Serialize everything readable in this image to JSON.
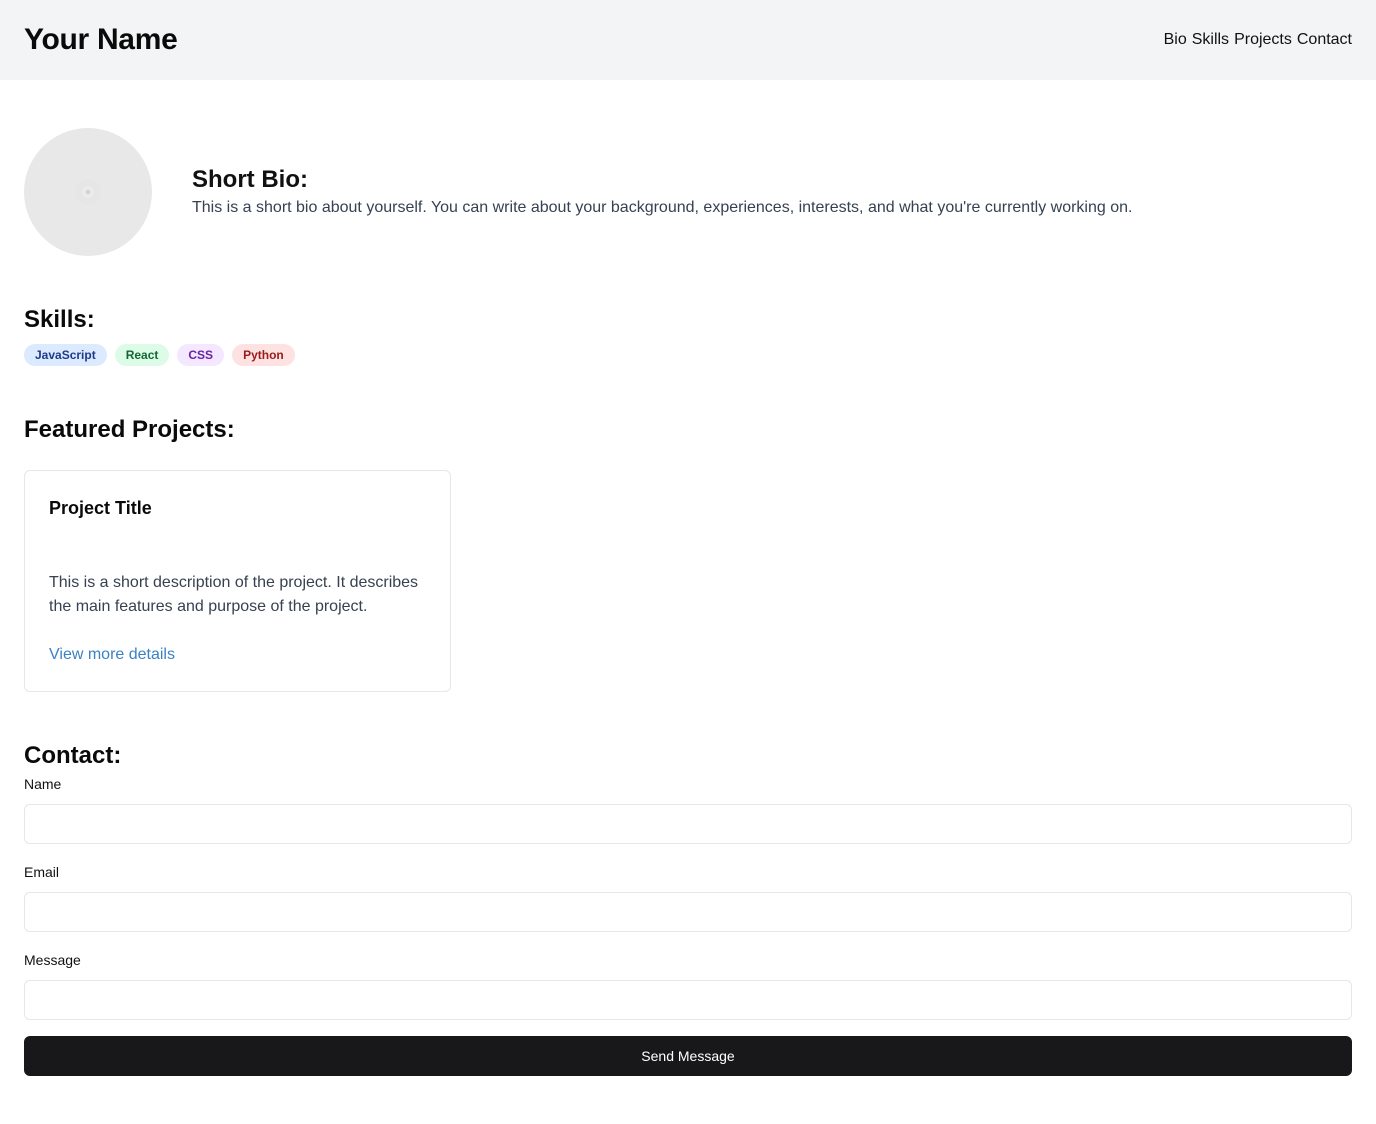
{
  "header": {
    "title": "Your Name",
    "nav": [
      {
        "label": "Bio"
      },
      {
        "label": "Skills"
      },
      {
        "label": "Projects"
      },
      {
        "label": "Contact"
      }
    ]
  },
  "bio": {
    "heading": "Short Bio:",
    "text": "This is a short bio about yourself. You can write about your background, experiences, interests, and what you're currently working on."
  },
  "skills": {
    "heading": "Skills:",
    "items": [
      {
        "label": "JavaScript",
        "bg": "#dbeafe",
        "color": "#1e3a8a"
      },
      {
        "label": "React",
        "bg": "#dcfce7",
        "color": "#166534"
      },
      {
        "label": "CSS",
        "bg": "#f3e8ff",
        "color": "#6b21a8"
      },
      {
        "label": "Python",
        "bg": "#fee2e2",
        "color": "#991b1b"
      }
    ]
  },
  "projects": {
    "heading": "Featured Projects:",
    "items": [
      {
        "title": "Project Title",
        "description": "This is a short description of the project. It describes the main features and purpose of the project.",
        "link_label": "View more details"
      }
    ]
  },
  "contact": {
    "heading": "Contact:",
    "fields": [
      {
        "label": "Name",
        "value": ""
      },
      {
        "label": "Email",
        "value": ""
      },
      {
        "label": "Message",
        "value": ""
      }
    ],
    "submit_label": "Send Message"
  },
  "colors": {
    "header_bg": "#f3f4f6",
    "button_bg": "#18181b",
    "link": "#3b82c4"
  }
}
